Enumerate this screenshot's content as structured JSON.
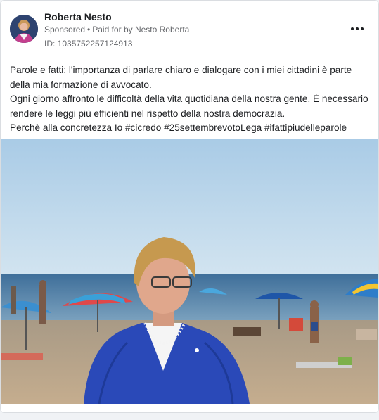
{
  "post": {
    "author": "Roberta Nesto",
    "sponsored": "Sponsored",
    "separator": "•",
    "paid_for": "Paid for by Nesto Roberta",
    "ad_id": "ID: 1035752257124913",
    "menu_icon": "more-horizontal-icon",
    "body_lines": [
      "Parole e fatti: l'importanza di parlare chiaro e dialogare con i miei cittadini è parte della mia formazione di avvocato.",
      "Ogni giorno affronto le difficoltà della vita quotidiana della nostra gente. È necessario rendere le leggi più efficienti nel rispetto della nostra democrazia.",
      "Perchè alla concretezza Io #cicredo #25settembrevotoLega #ifattipiudelleparole"
    ]
  },
  "colors": {
    "text_primary": "#1c1e21",
    "text_secondary": "#65676b",
    "card_border": "#dadde1",
    "sky": "#b9d6ec",
    "sea": "#4f7fa6",
    "sand": "#b8a48a",
    "jacket": "#2a49b8"
  }
}
